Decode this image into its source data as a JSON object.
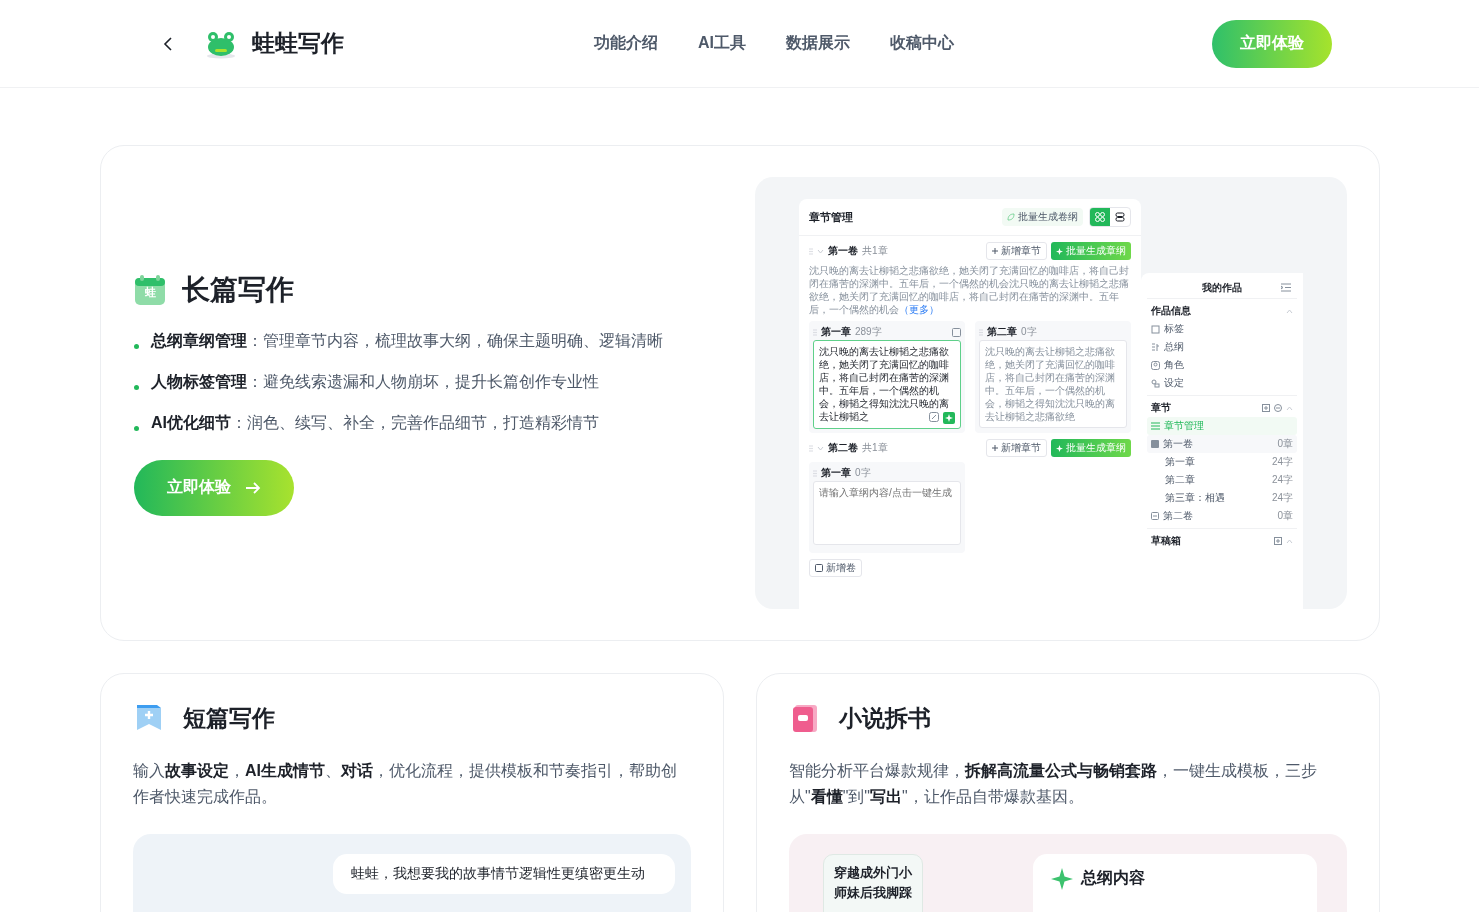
{
  "header": {
    "brand": "蛙蛙写作",
    "nav": [
      {
        "label": "功能介绍"
      },
      {
        "label": "AI工具"
      },
      {
        "label": "数据展示"
      },
      {
        "label": "收稿中心"
      }
    ],
    "cta": "立即体验"
  },
  "long_form": {
    "icon_text": "蛙",
    "title": "长篇写作",
    "features": [
      "**总纲章纲管理**：管理章节内容，梳理故事大纲，确保主题明确、逻辑清晰",
      "**人物标签管理**：避免线索遗漏和人物崩坏，提升长篇创作专业性",
      "**AI优化细节**：润色、续写、补全，完善作品细节，打造精彩情节"
    ],
    "button": "立即体验",
    "mockup": {
      "panel_title": "章节管理",
      "batch_volume": "批量生成卷纲",
      "view_toggle": [
        {
          "kind": "grid",
          "selected": true
        },
        {
          "kind": "list",
          "selected": false
        }
      ],
      "volumes": [
        {
          "title": "第一卷",
          "count": "共1章",
          "add": "新增章节",
          "batch": "批量生成章纲",
          "expanded": true,
          "summary": "沈只晚的离去让柳韬之悲痛欲绝，她关闭了充满回忆的咖啡店，将自己封闭在痛苦的深渊中。五年后，一个偶然的机会沈只晚的离去让柳韬之悲痛欲绝，她关闭了充满回忆的咖啡店，将自己封闭在痛苦的深渊中。五年后，一个偶然的机会",
          "more": "（更多）",
          "chapters": [
            {
              "title": "第一章",
              "words": "289字",
              "text": "沈只晚的离去让柳韬之悲痛欲绝，她关闭了充满回忆的咖啡店，将自己封闭在痛苦的深渊中。五年后，一个偶然的机会，柳韬之得知沈沈只晚的离去让柳韬之",
              "selected": true
            },
            {
              "title": "第二章",
              "words": "0字",
              "text": "沈只晚的离去让柳韬之悲痛欲绝，她关闭了充满回忆的咖啡店，将自己封闭在痛苦的深渊中。五年后，一个偶然的机会，柳韬之得知沈沈只晚的离去让柳韬之悲痛欲绝",
              "selected": false
            }
          ]
        },
        {
          "title": "第二卷",
          "count": "共1章",
          "add": "新增章节",
          "batch": "批量生成章纲",
          "expanded": true,
          "chapters": [
            {
              "title": "第一章",
              "words": "0字",
              "placeholder": "请输入章纲内容/点击一键生成",
              "selected": false
            }
          ]
        }
      ],
      "add_volume": "新增卷",
      "sidebar": {
        "title": "我的作品",
        "sections": [
          {
            "title": "作品信息",
            "kind": "info",
            "expanded": true,
            "items": [
              {
                "label": "标签",
                "kind": "tag"
              },
              {
                "label": "总纲",
                "kind": "outline"
              },
              {
                "label": "角色",
                "kind": "character"
              },
              {
                "label": "设定",
                "kind": "setting"
              }
            ]
          },
          {
            "title": "章节",
            "kind": "chapters",
            "expanded": true,
            "items": [
              {
                "label": "章节管理",
                "kind": "manage",
                "selected": true
              },
              {
                "label": "第一卷",
                "kind": "volume",
                "count": "0章",
                "expanded": true,
                "selected": false,
                "children": [
                  {
                    "label": "第一章",
                    "count": "24字",
                    "selected": false
                  },
                  {
                    "label": "第二章",
                    "count": "24字",
                    "selected": false
                  },
                  {
                    "label": "第三章：相遇",
                    "count": "24字",
                    "selected": false
                  }
                ]
              },
              {
                "label": "第二卷",
                "kind": "volume",
                "count": "0章",
                "expanded": false,
                "selected": false
              }
            ]
          },
          {
            "title": "草稿箱",
            "kind": "drafts",
            "expanded": true
          }
        ]
      }
    }
  },
  "short_form": {
    "title": "短篇写作",
    "description": "输入**故事设定**，**AI生成情节**、**对话**，优化流程，提供模板和节奏指引，帮助创作者快速完成作品。",
    "chat_message": "蛙蛙，我想要我的故事情节逻辑性更缜密更生动"
  },
  "book_analysis": {
    "title": "小说拆书",
    "description": "智能分析平台爆款规律，**拆解高流量公式与畅销套路**，一键生成模板，三步从\"**看懂**\"到\"**写出**\"，让作品自带爆款基因。",
    "book_tag": "穿越成外门小师妹后我脚踩",
    "outline_title": "总纲内容"
  }
}
